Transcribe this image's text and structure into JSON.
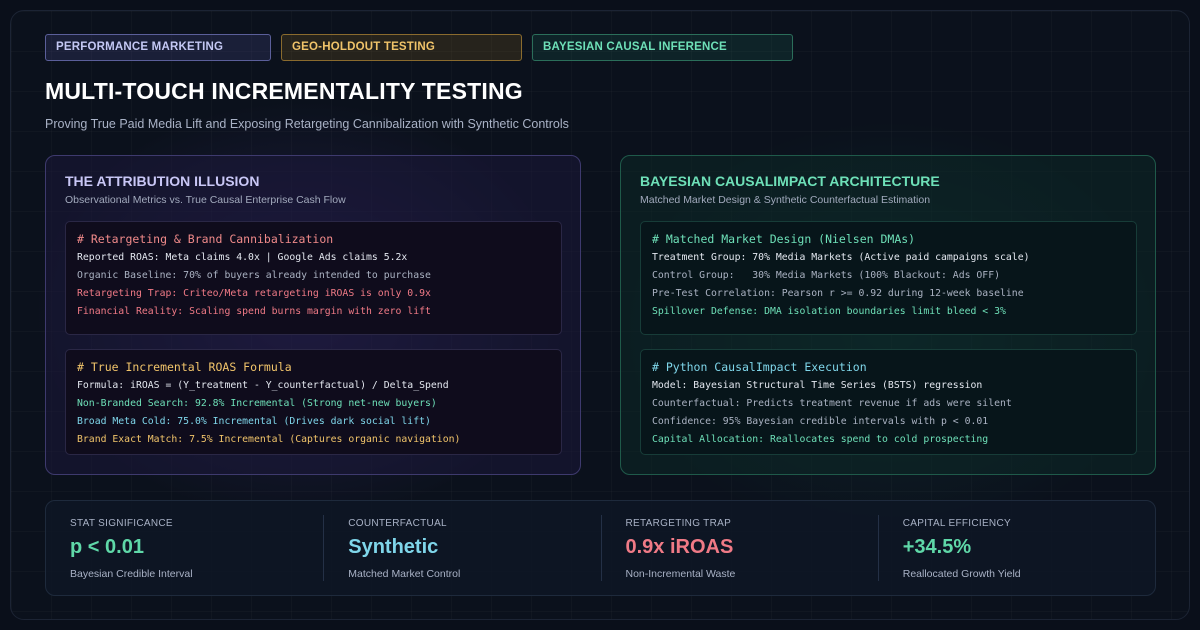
{
  "tags": [
    "PERFORMANCE MARKETING",
    "GEO-HOLDOUT TESTING",
    "BAYESIAN CAUSAL INFERENCE"
  ],
  "header": {
    "title": "MULTI-TOUCH INCREMENTALITY TESTING",
    "subtitle": "Proving True Paid Media Lift and Exposing Retargeting Cannibalization with Synthetic Controls"
  },
  "left_panel": {
    "title": "THE ATTRIBUTION ILLUSION",
    "subtitle": "Observational Metrics vs. True Causal Enterprise Cash Flow",
    "block1": {
      "heading": "# Retargeting & Brand Cannibalization",
      "lines": [
        "Reported ROAS: Meta claims 4.0x | Google Ads claims 5.2x",
        "Organic Baseline: 70% of buyers already intended to purchase",
        "Retargeting Trap: Criteo/Meta retargeting iROAS is only 0.9x",
        "Financial Reality: Scaling spend burns margin with zero lift"
      ]
    },
    "block2": {
      "heading": "# True Incremental ROAS Formula",
      "lines": [
        "Formula: iROAS = (Y_treatment - Y_counterfactual) / Delta_Spend",
        "Non-Branded Search: 92.8% Incremental (Strong net-new buyers)",
        "Broad Meta Cold: 75.0% Incremental (Drives dark social lift)",
        "Brand Exact Match: 7.5% Incremental (Captures organic navigation)"
      ]
    }
  },
  "right_panel": {
    "title": "BAYESIAN CAUSALIMPACT ARCHITECTURE",
    "subtitle": "Matched Market Design & Synthetic Counterfactual Estimation",
    "block1": {
      "heading": "# Matched Market Design (Nielsen DMAs)",
      "lines": [
        "Treatment Group: 70% Media Markets (Active paid campaigns scale)",
        "Control Group:   30% Media Markets (100% Blackout: Ads OFF)",
        "Pre-Test Correlation: Pearson r >= 0.92 during 12-week baseline",
        "Spillover Defense: DMA isolation boundaries limit bleed < 3%"
      ]
    },
    "block2": {
      "heading": "# Python CausalImpact Execution",
      "lines": [
        "Model: Bayesian Structural Time Series (BSTS) regression",
        "Counterfactual: Predicts treatment revenue if ads were silent",
        "Confidence: 95% Bayesian credible intervals with p < 0.01",
        "Capital Allocation: Reallocates spend to cold prospecting"
      ]
    }
  },
  "stats": [
    {
      "label": "STAT SIGNIFICANCE",
      "value": "p < 0.01",
      "desc": "Bayesian Credible Interval",
      "color": "#5fd8a8"
    },
    {
      "label": "COUNTERFACTUAL",
      "value": "Synthetic",
      "desc": "Matched Market Control",
      "color": "#7fd6ea"
    },
    {
      "label": "RETARGETING TRAP",
      "value": "0.9x iROAS",
      "desc": "Non-Incremental Waste",
      "color": "#f07a86"
    },
    {
      "label": "CAPITAL EFFICIENCY",
      "value": "+34.5%",
      "desc": "Reallocated Growth Yield",
      "color": "#5fd8a8"
    }
  ]
}
